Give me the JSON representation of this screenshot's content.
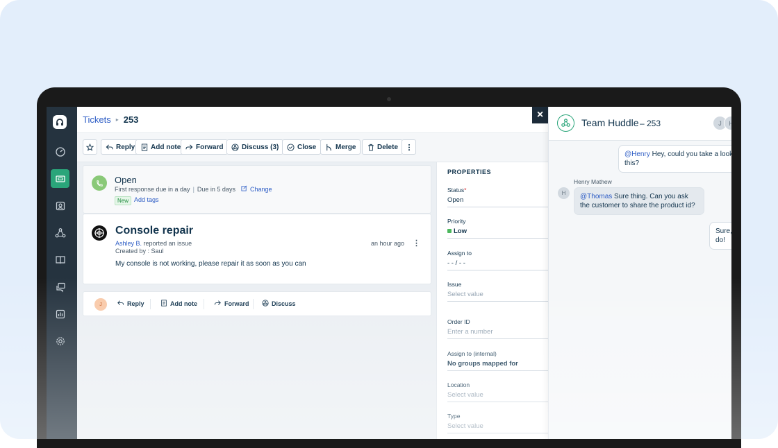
{
  "breadcrumb": {
    "parent": "Tickets",
    "separator": "▸",
    "ticket_id": "253"
  },
  "toolbar": {
    "reply": "Reply",
    "add_note": "Add note",
    "forward": "Forward",
    "discuss": "Discuss (3)",
    "close": "Close",
    "merge": "Merge",
    "delete": "Delete"
  },
  "status": {
    "title": "Open",
    "first_response": "First response due in a day",
    "divider": "|",
    "due": "Due in 5 days",
    "change": "Change",
    "tag": "New",
    "add_tags": "Add tags"
  },
  "ticket": {
    "title": "Console repair",
    "reporter": "Ashley B.",
    "reported_text": "reported an issue",
    "created_by": "Created by : Saul",
    "body": "My console is not working, please repair it as soon as you can",
    "time": "an hour ago"
  },
  "reply_bar": {
    "avatar_initial": "J",
    "reply": "Reply",
    "add_note": "Add note",
    "forward": "Forward",
    "discuss": "Discuss"
  },
  "properties": {
    "heading": "PROPERTIES",
    "fields": [
      {
        "label": "Status",
        "required": "*",
        "value": "Open"
      },
      {
        "label": "Priority",
        "value": "Low"
      },
      {
        "label": "Assign to",
        "value": "- - / - -"
      },
      {
        "label": "Issue",
        "placeholder": "Select value"
      },
      {
        "label": "Order ID",
        "placeholder": "Enter a number"
      },
      {
        "label": "Assign to (internal)",
        "value": "No groups mapped for"
      },
      {
        "label": "Location",
        "placeholder": "Select value"
      },
      {
        "label": "Type",
        "placeholder": "Select value"
      }
    ]
  },
  "huddle": {
    "close_label": "×",
    "title": "Team Huddle",
    "ticket_ref": "– 253",
    "avatars": [
      "J",
      "H",
      "···"
    ],
    "messages": [
      {
        "mention": "@Henry",
        "text": " Hey, could you take a look at this?",
        "author": "Me"
      },
      {
        "sender": "Henry Mathew",
        "avatar": "H",
        "mention": "@Thomas",
        "text": " Sure thing. Can you ask the customer to share the product id?"
      },
      {
        "text": "Sure, will do!",
        "author": "Me"
      }
    ]
  },
  "colors": {
    "accent": "#2aa57a",
    "link": "#2c5cc5",
    "sidebar": "#25333f",
    "backdrop": "#e3eefb"
  }
}
